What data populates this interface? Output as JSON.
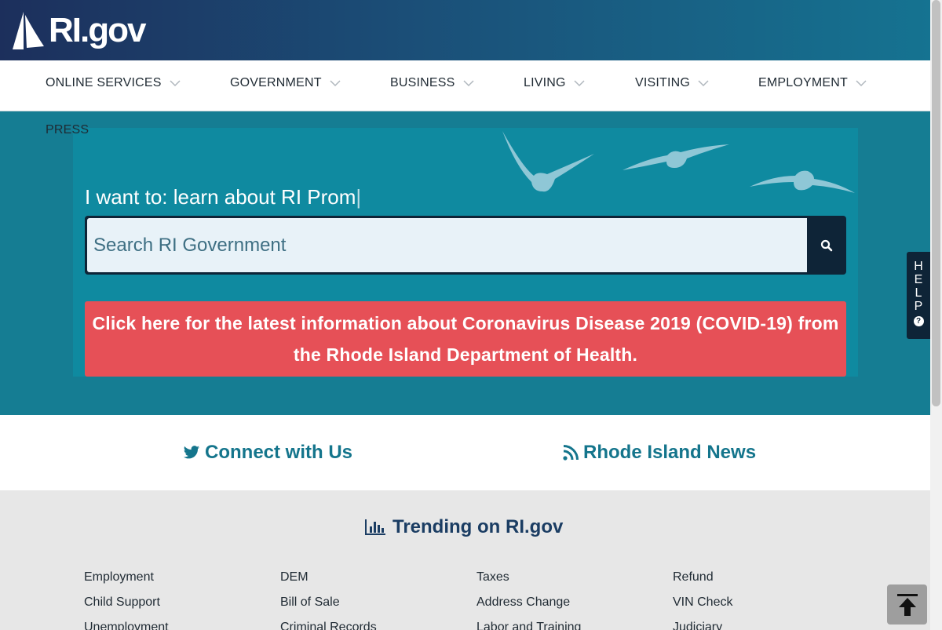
{
  "header": {
    "logo_text": "RI.gov"
  },
  "nav": {
    "items": [
      {
        "label": "ONLINE SERVICES"
      },
      {
        "label": "GOVERNMENT"
      },
      {
        "label": "BUSINESS"
      },
      {
        "label": "LIVING"
      },
      {
        "label": "VISITING"
      },
      {
        "label": "EMPLOYMENT"
      },
      {
        "label": "PRESS"
      }
    ]
  },
  "hero": {
    "prompt_text": "I want to: learn about RI Prom",
    "cursor": "|",
    "search_placeholder": "Search RI Government",
    "covid_banner": "Click here for the latest information about Coronavirus Disease 2019 (COVID-19) from the Rhode Island Department of Health."
  },
  "help_tab": {
    "letters": [
      "H",
      "E",
      "L",
      "P"
    ],
    "icon": "question-circle-icon",
    "icon_glyph": "?"
  },
  "connect": {
    "twitter_label": "Connect with Us",
    "news_label": "Rhode Island News"
  },
  "trending": {
    "title": "Trending on RI.gov",
    "columns": [
      [
        "Employment",
        "Child Support",
        "Unemployment"
      ],
      [
        "DEM",
        "Bill of Sale",
        "Criminal Records"
      ],
      [
        "Taxes",
        "Address Change",
        "Labor and Training"
      ],
      [
        "Refund",
        "VIN Check",
        "Judiciary"
      ]
    ]
  },
  "colors": {
    "header_dark": "#1c2f5c",
    "hero_teal": "#157d93",
    "covid_red": "#e65057",
    "link_teal": "#14758c",
    "trend_navy": "#1b3d63"
  }
}
